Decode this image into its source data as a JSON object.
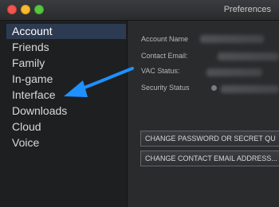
{
  "window": {
    "title": "Preferences"
  },
  "sidebar": {
    "items": [
      {
        "label": "Account",
        "selected": true
      },
      {
        "label": "Friends"
      },
      {
        "label": "Family"
      },
      {
        "label": "In-game"
      },
      {
        "label": "Interface"
      },
      {
        "label": "Downloads"
      },
      {
        "label": "Cloud"
      },
      {
        "label": "Voice"
      }
    ]
  },
  "account": {
    "fields": [
      {
        "label": "Account Name"
      },
      {
        "label": "Contact Email:"
      },
      {
        "label": "VAC Status:"
      },
      {
        "label": "Security Status"
      }
    ],
    "buttons": {
      "change_password": "CHANGE PASSWORD OR SECRET QU",
      "change_email": "CHANGE CONTACT EMAIL ADDRESS..."
    }
  },
  "colors": {
    "arrow": "#1e90ff",
    "selection": "#2d3b52"
  }
}
